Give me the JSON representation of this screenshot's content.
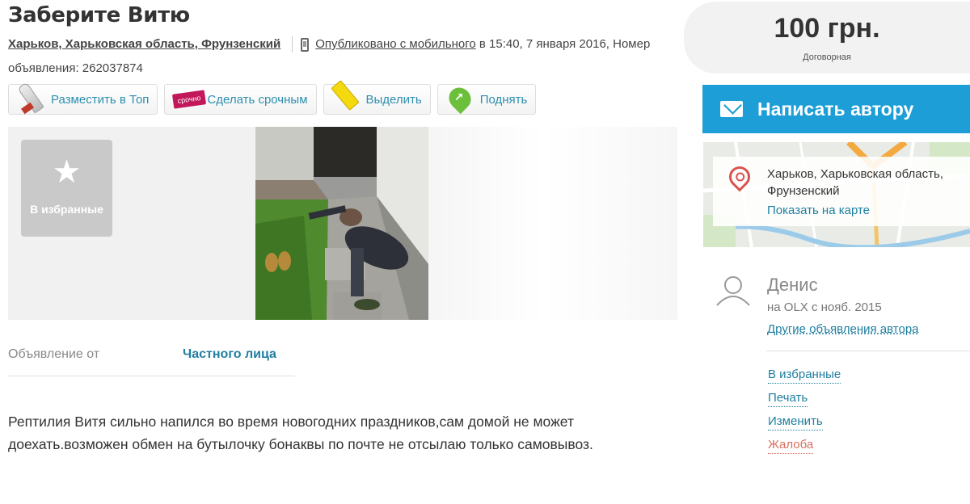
{
  "ad": {
    "title": "Заберите Витю",
    "location": "Харьков, Харьковская область, Фрунзенский",
    "published_mobile": "Опубликовано с мобильного",
    "published_rest": " в 15:40, 7 января 2016, Номер объявления: 262037874"
  },
  "actions": [
    {
      "label": "Разместить в Топ",
      "icon": "rocket-icon"
    },
    {
      "label": "Сделать срочным",
      "icon": "urgent-label-icon"
    },
    {
      "label": "Выделить",
      "icon": "marker-icon"
    },
    {
      "label": "Поднять",
      "icon": "lift-up-icon"
    }
  ],
  "gallery": {
    "favorite_label": "В избранные",
    "favorite_icon": "star-icon"
  },
  "details": {
    "from_key": "Объявление от",
    "from_value": "Частного лица"
  },
  "description": "Рептилия Витя сильно напился во время новогодних праздников,сам домой не может доехать.возможен обмен на бутылочку бонаквы по почте не отсылаю только самовывоз.",
  "sidebar": {
    "price": "100 грн.",
    "price_note": "Договорная",
    "write_button": "Написать автору",
    "map_address": "Харьков, Харьковская область, Фрунзенский",
    "map_link": "Показать на карте",
    "user_name": "Денис",
    "user_since": "на OLX с нояб. 2015",
    "user_other_ads": "Другие объявления автора",
    "links": [
      "В избранные",
      "Печать",
      "Изменить",
      "Жалоба"
    ]
  },
  "colors": {
    "accent": "#1d9ed6",
    "link": "#1f7fa0",
    "report": "#d9705f",
    "urgent": "#c2185b"
  }
}
